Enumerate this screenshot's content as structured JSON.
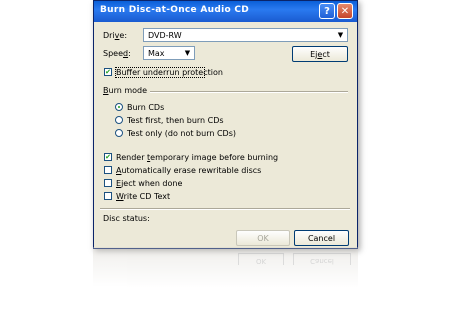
{
  "window": {
    "title": "Burn Disc-at-Once Audio CD",
    "help_glyph": "?",
    "close_glyph": "✕"
  },
  "drive": {
    "label_pre": "Dri",
    "label_accel": "v",
    "label_post": "e:",
    "value": "DVD-RW"
  },
  "speed": {
    "label_pre": "Spee",
    "label_accel": "d",
    "label_post": ":",
    "value": "Max"
  },
  "eject_button": {
    "pre": "Ej",
    "accel": "e",
    "post": "ct"
  },
  "buffer_protection": {
    "label": "Buffer underrun protection",
    "checked": true
  },
  "burn_mode": {
    "heading_accel": "B",
    "heading_rest": "urn mode",
    "options": [
      {
        "label": "Burn CDs",
        "selected": true
      },
      {
        "label": "Test first, then burn CDs",
        "selected": false
      },
      {
        "label": "Test only (do not burn CDs)",
        "selected": false
      }
    ]
  },
  "options": {
    "render_temp": {
      "pre": "Render ",
      "accel": "t",
      "post": "emporary image before burning",
      "checked": true
    },
    "auto_erase": {
      "pre": "",
      "accel": "A",
      "post": "utomatically erase rewritable discs",
      "checked": false
    },
    "eject_when_done": {
      "pre": "",
      "accel": "E",
      "post": "ject when done",
      "checked": false
    },
    "write_cd_text": {
      "pre": "",
      "accel": "W",
      "post": "rite CD Text",
      "checked": false
    }
  },
  "disc_status": {
    "label": "Disc status:"
  },
  "ok_button": {
    "label": "OK",
    "enabled": false
  },
  "cancel_button": {
    "label": "Cancel"
  },
  "icons": {
    "dropdown": "chevron-down-icon",
    "check": "check-icon"
  },
  "colors": {
    "titlebar": "#0a5fd8",
    "dialog_bg": "#ece9d8",
    "check_mark": "#21a121",
    "close_button": "#c5452b"
  }
}
